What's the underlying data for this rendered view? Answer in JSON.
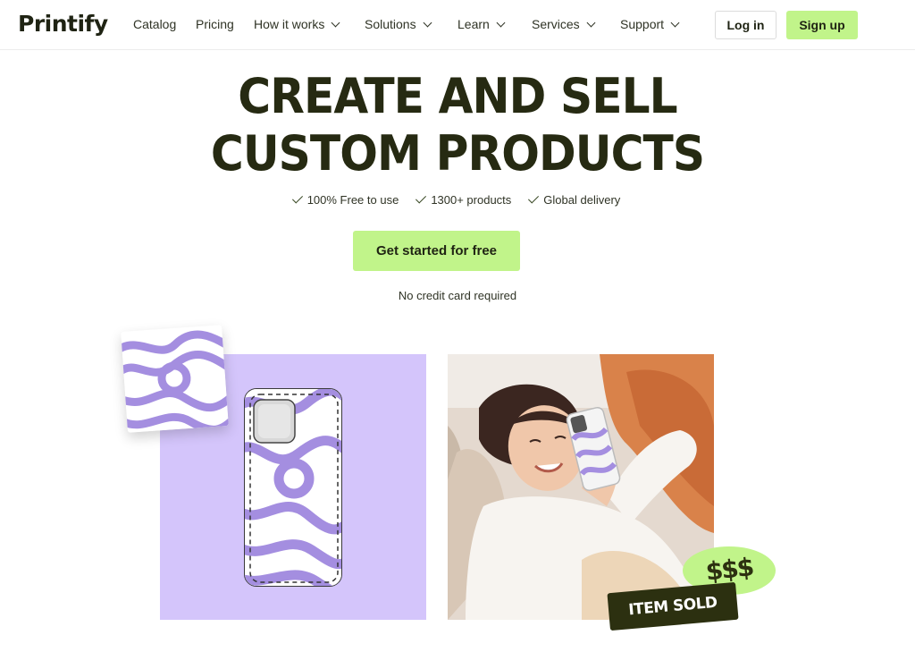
{
  "brand": {
    "name": "Printify"
  },
  "nav": {
    "items": [
      {
        "label": "Catalog",
        "dropdown": false
      },
      {
        "label": "Pricing",
        "dropdown": false
      },
      {
        "label": "How it works",
        "dropdown": true
      },
      {
        "label": "Solutions",
        "dropdown": true
      },
      {
        "label": "Learn",
        "dropdown": true
      },
      {
        "label": "Services",
        "dropdown": true
      },
      {
        "label": "Support",
        "dropdown": true
      }
    ],
    "login_label": "Log in",
    "signup_label": "Sign up"
  },
  "hero": {
    "title_line1": "CREATE AND SELL",
    "title_line2": "CUSTOM PRODUCTS",
    "features": [
      "100% Free to use",
      "1300+ products",
      "Global delivery"
    ],
    "cta_label": "Get started for free",
    "cta_note": "No credit card required"
  },
  "showcase": {
    "money_label": "$$$",
    "sold_label": "ITEM SOLD"
  },
  "colors": {
    "accent_green": "#c1f48a",
    "dark_text": "#262a12",
    "lavender": "#d4c5fb",
    "swirl_purple": "#a48ee0",
    "badge_dark": "#2c3010"
  },
  "icons": [
    "chevron-down-icon",
    "check-icon"
  ]
}
